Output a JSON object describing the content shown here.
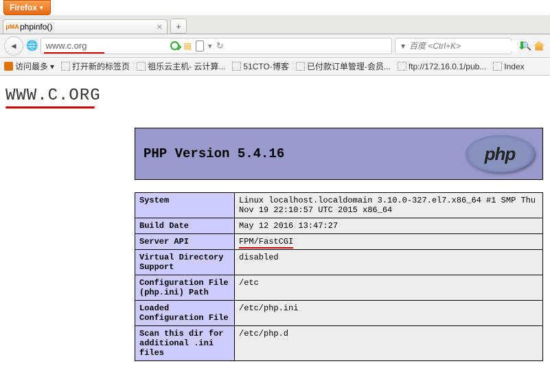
{
  "browser": {
    "button_label": "Firefox",
    "tab_title": "phpinfo()",
    "url": "www.c.org",
    "search_placeholder": "百度 <Ctrl+K>"
  },
  "bookmarks": [
    {
      "label": "访问最多",
      "dropdown": true
    },
    {
      "label": "打开新的标签页"
    },
    {
      "label": "祖乐云主机- 云计算..."
    },
    {
      "label": "51CTO-博客"
    },
    {
      "label": "已付款订单管理-会员..."
    },
    {
      "label": "ftp://172.16.0.1/pub..."
    },
    {
      "label": "Index"
    }
  ],
  "page": {
    "hostname": "WWW.C.ORG",
    "php_title": "PHP Version 5.4.16",
    "php_logo_text": "php",
    "rows": [
      {
        "k": "System",
        "v": "Linux localhost.localdomain 3.10.0-327.el7.x86_64 #1 SMP Thu Nov 19 22:10:57 UTC 2015 x86_64"
      },
      {
        "k": "Build Date",
        "v": "May 12 2016 13:47:27"
      },
      {
        "k": "Server API",
        "v": "FPM/FastCGI",
        "highlight": true
      },
      {
        "k": "Virtual Directory Support",
        "v": "disabled"
      },
      {
        "k": "Configuration File (php.ini) Path",
        "v": "/etc"
      },
      {
        "k": "Loaded Configuration File",
        "v": "/etc/php.ini"
      },
      {
        "k": "Scan this dir for additional .ini files",
        "v": "/etc/php.d"
      }
    ]
  }
}
